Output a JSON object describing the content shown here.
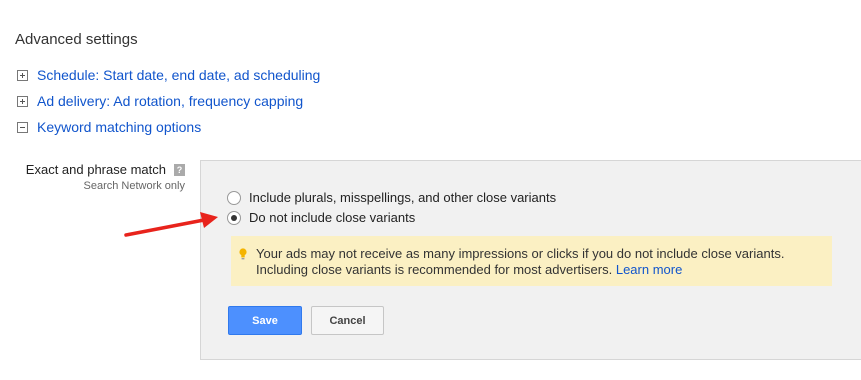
{
  "section_title": "Advanced settings",
  "expanders": [
    {
      "label": "Schedule: Start date, end date, ad scheduling",
      "state": "collapsed"
    },
    {
      "label": "Ad delivery: Ad rotation, frequency capping",
      "state": "collapsed"
    },
    {
      "label": "Keyword matching options",
      "state": "expanded"
    }
  ],
  "field": {
    "label": "Exact and phrase match",
    "help_glyph": "?",
    "sublabel": "Search Network only"
  },
  "options": [
    {
      "label": "Include plurals, misspellings, and other close variants",
      "selected": false
    },
    {
      "label": "Do not include close variants",
      "selected": true
    }
  ],
  "notice": {
    "line1": "Your ads may not receive as many impressions or clicks if you do not include close variants.",
    "line2": "Including close variants is recommended for most advertisers.",
    "link": "Learn more"
  },
  "buttons": {
    "save": "Save",
    "cancel": "Cancel"
  },
  "colors": {
    "link": "#1155cc",
    "primary_button": "#4d90fe",
    "notice_bg": "#fbf0c3",
    "arrow": "#e8231c"
  }
}
